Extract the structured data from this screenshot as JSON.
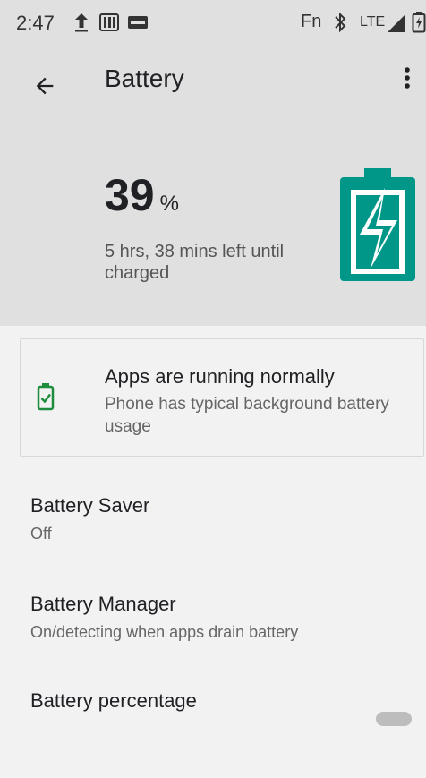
{
  "status_bar": {
    "time": "2:47",
    "fn": "Fn",
    "network": "LTE"
  },
  "header": {
    "title": "Battery",
    "percent_value": "39",
    "percent_unit": "%",
    "charge_estimate": "5 hrs, 38 mins left until charged"
  },
  "status_card": {
    "title": "Apps are running normally",
    "subtitle": "Phone has typical background battery usage"
  },
  "settings": [
    {
      "title": "Battery Saver",
      "summary": "Off"
    },
    {
      "title": "Battery Manager",
      "summary": "On/detecting when apps drain battery"
    },
    {
      "title": "Battery percentage",
      "summary": ""
    }
  ],
  "icons": {
    "back": "arrow-left-icon",
    "menu": "more-vert-icon",
    "battery_large": "battery-charging-icon",
    "card": "battery-check-icon"
  },
  "colors": {
    "accent": "#009688",
    "header_bg": "#e0e0e0",
    "page_bg": "#f2f2f2",
    "card_icon": "#1e8e3e"
  }
}
